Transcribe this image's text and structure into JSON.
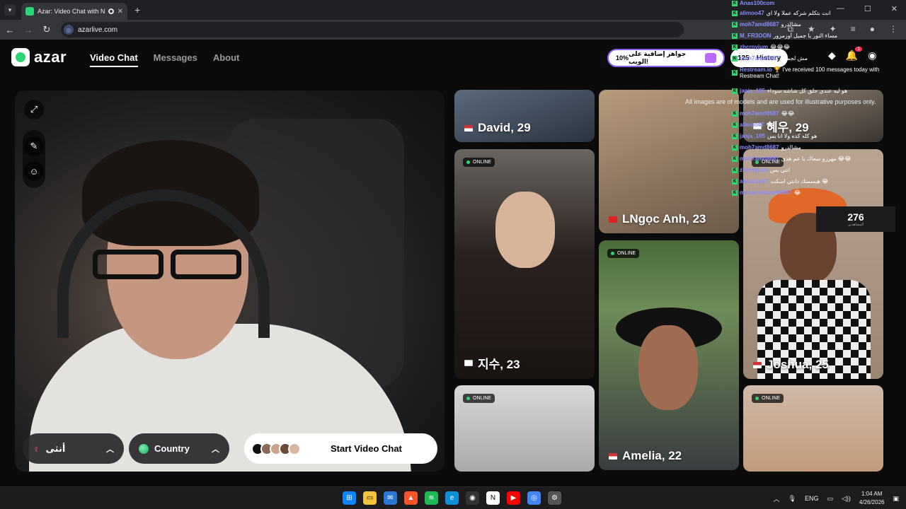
{
  "browser": {
    "tab_title": "Azar: Video Chat with New",
    "url": "azarlive.com"
  },
  "app": {
    "logo_text": "azar",
    "nav": [
      {
        "label": "Video Chat",
        "active": true
      },
      {
        "label": "Messages",
        "active": false
      },
      {
        "label": "About",
        "active": false
      }
    ],
    "promo_percent": "10%",
    "promo_text": "جواهر إضافية على الويب!",
    "coins": "125",
    "history_label": "History",
    "notification_count": "1"
  },
  "video_panel": {
    "gender_label": "أنثى",
    "country_label": "Country",
    "start_label": "Start Video Chat"
  },
  "disclaimer": "All images are of models and are used for illustrative purposes only.",
  "viewer_count": "276",
  "viewer_count_sub": "المشاهدين",
  "cards": [
    {
      "name": "David, 29",
      "online": false
    },
    {
      "name": "LNgọc Anh, 23",
      "online": false
    },
    {
      "name": "혜우, 29",
      "online": true
    },
    {
      "name": "지수, 23",
      "online": true
    },
    {
      "name": "Amelia, 22",
      "online": true
    },
    {
      "name": "Joshua, 25",
      "online": true
    },
    {
      "name": "",
      "online": true
    },
    {
      "name": "",
      "online": true
    }
  ],
  "online_label": "ONLINE",
  "chat": [
    {
      "user": "Anas100com",
      "text": ""
    },
    {
      "user": "alimoo47",
      "text": "انت بتكلم شركه عملا ولا اي"
    },
    {
      "user": "moh7amd8687",
      "text": "مشالدرو"
    },
    {
      "user": "M_FR3OON",
      "text": "مساء النور يا جميل أوزمرور"
    },
    {
      "user": "zhcrnyjum",
      "text": "😂😂😂"
    },
    {
      "user": "moh7amd8687",
      "text": "مش لجميل"
    },
    {
      "user": "Restream.io",
      "text": "🏆 I've received 100 messages today with Restream Chat!"
    },
    {
      "user": "janja_105",
      "text": "هو ليه عندي حلق كل شاشه سوداء"
    },
    {
      "user": "moh7amd8687",
      "text": "😂😂"
    },
    {
      "user": "alimoo47",
      "text": "😂"
    },
    {
      "user": "janja_105",
      "text": "هو كله كده ولا انا بس"
    },
    {
      "user": "moh7amd8687",
      "text": "مشالدرو"
    },
    {
      "user": "moh7amd8687",
      "text": "مهرزو سعاك يا عم هدي 😂😂"
    },
    {
      "user": "zhcrnyjum",
      "text": "انتي بس"
    },
    {
      "user": "abuazzo47",
      "text": "هيسمتك دانتي اسكت 😂"
    },
    {
      "user": "mohamedsami8887",
      "text": "😂"
    }
  ],
  "taskbar": {
    "lang": "ENG",
    "time": "1:04 AM",
    "date": "4/26/2026"
  }
}
